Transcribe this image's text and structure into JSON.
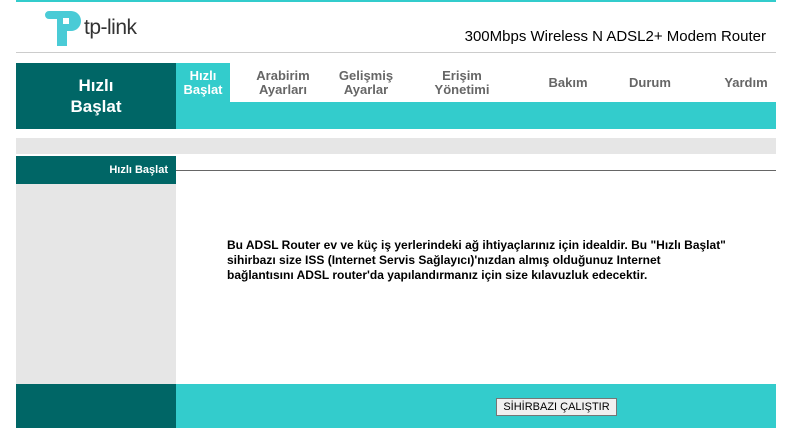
{
  "header": {
    "brand": "tp-link",
    "model": "300Mbps Wireless N ADSL2+ Modem Router"
  },
  "nav": {
    "title_line1": "Hızlı",
    "title_line2": "Başlat",
    "tabs": [
      {
        "line1": "Hızlı",
        "line2": "Başlat"
      },
      {
        "line1": "Arabirim",
        "line2": "Ayarları"
      },
      {
        "line1": "Gelişmiş",
        "line2": "Ayarlar"
      },
      {
        "line1": "Erişim",
        "line2": "Yönetimi"
      },
      {
        "line1": "Bakım",
        "line2": ""
      },
      {
        "line1": "Durum",
        "line2": ""
      },
      {
        "line1": "Yardım",
        "line2": ""
      }
    ]
  },
  "section": {
    "title": "Hızlı Başlat",
    "description_line1": "Bu ADSL Router ev ve küç iş yerlerindeki ağ ihtiyaçlarınız için idealdir. Bu \"Hızlı Başlat\"",
    "description_line2": "sihirbazı size ISS (Internet Servis Sağlayıcı)'nızdan almış olduğunuz Internet",
    "description_line3": "bağlantısını ADSL router'da yapılandırmanız için size kılavuzluk edecektir."
  },
  "footer": {
    "run_button": "SİHİRBAZI ÇALIŞTIR"
  },
  "colors": {
    "dark_teal": "#006666",
    "teal": "#33cccc",
    "gray": "#e6e6e6"
  }
}
